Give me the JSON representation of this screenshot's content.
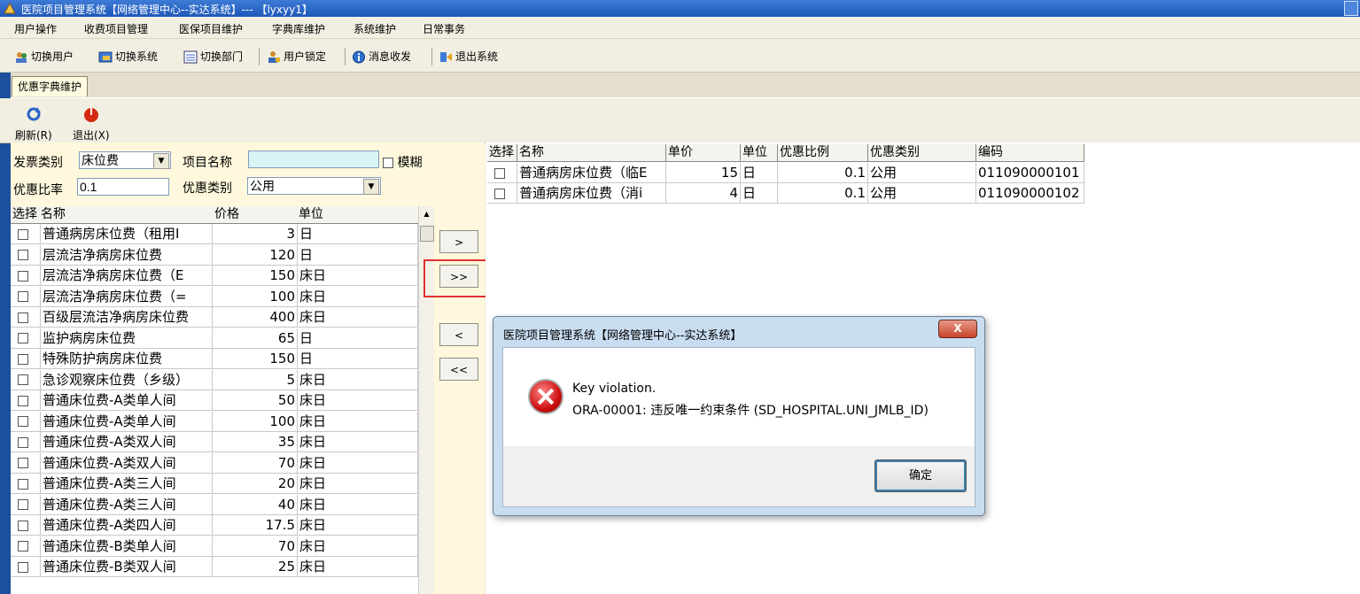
{
  "window": {
    "title": "医院项目管理系统【网络管理中心--实达系统】--- 【lyxyy1】"
  },
  "menu": [
    "用户操作",
    "收费项目管理",
    "医保项目维护",
    "字典库维护",
    "系统维护",
    "日常事务"
  ],
  "toolbar": [
    {
      "label": "切换用户",
      "icon": "users-icon"
    },
    {
      "label": "切换系统",
      "icon": "switch-system-icon"
    },
    {
      "label": "切换部门",
      "icon": "department-icon"
    },
    {
      "label": "用户锁定",
      "icon": "lock-user-icon"
    },
    {
      "label": "消息收发",
      "icon": "info-icon"
    },
    {
      "label": "退出系统",
      "icon": "exit-icon"
    }
  ],
  "tab": {
    "label": "优惠字典维护"
  },
  "actions": {
    "refresh": "刷新(R)",
    "exit": "退出(X)"
  },
  "filter": {
    "invoice_type_label": "发票类别",
    "invoice_type_value": "床位费",
    "item_name_label": "项目名称",
    "item_name_value": "",
    "fuzzy_label": "模糊",
    "discount_rate_label": "优惠比率",
    "discount_rate_value": "0.1",
    "discount_type_label": "优惠类别",
    "discount_type_value": "公用"
  },
  "left_grid": {
    "headers": [
      "选择",
      "名称",
      "价格",
      "单位"
    ],
    "rows": [
      {
        "name": "普通病房床位费（租用I",
        "price": "3",
        "unit": "日"
      },
      {
        "name": "层流洁净病房床位费",
        "price": "120",
        "unit": "日"
      },
      {
        "name": "层流洁净病房床位费（E",
        "price": "150",
        "unit": "床日"
      },
      {
        "name": "层流洁净病房床位费（=",
        "price": "100",
        "unit": "床日"
      },
      {
        "name": "百级层流洁净病房床位费",
        "price": "400",
        "unit": "床日"
      },
      {
        "name": "监护病房床位费",
        "price": "65",
        "unit": "日"
      },
      {
        "name": "特殊防护病房床位费",
        "price": "150",
        "unit": "日"
      },
      {
        "name": "急诊观察床位费（乡级）",
        "price": "5",
        "unit": "床日"
      },
      {
        "name": "普通床位费-A类单人间",
        "price": "50",
        "unit": "床日"
      },
      {
        "name": "普通床位费-A类单人间",
        "price": "100",
        "unit": "床日"
      },
      {
        "name": "普通床位费-A类双人间",
        "price": "35",
        "unit": "床日"
      },
      {
        "name": "普通床位费-A类双人间",
        "price": "70",
        "unit": "床日"
      },
      {
        "name": "普通床位费-A类三人间",
        "price": "20",
        "unit": "床日"
      },
      {
        "name": "普通床位费-A类三人间",
        "price": "40",
        "unit": "床日"
      },
      {
        "name": "普通床位费-A类四人间",
        "price": "17.5",
        "unit": "床日"
      },
      {
        "name": "普通床位费-B类单人间",
        "price": "70",
        "unit": "床日"
      },
      {
        "name": "普通床位费-B类双人间",
        "price": "25",
        "unit": "床日"
      }
    ]
  },
  "transfer_buttons": [
    ">",
    ">>",
    "<",
    "<<"
  ],
  "right_grid": {
    "headers": [
      "选择",
      "名称",
      "单价",
      "单位",
      "优惠比例",
      "优惠类别",
      "编码"
    ],
    "rows": [
      {
        "name": "普通病房床位费（临E",
        "price": "15",
        "unit": "日",
        "ratio": "0.1",
        "type": "公用",
        "code": "011090000101"
      },
      {
        "name": "普通病房床位费（消i",
        "price": "4",
        "unit": "日",
        "ratio": "0.1",
        "type": "公用",
        "code": "011090000102"
      }
    ]
  },
  "dialog": {
    "title": "医院项目管理系统【网络管理中心--实达系统】",
    "close": "X",
    "message_line1": "Key violation.",
    "message_line2": "ORA-00001: 违反唯一约束条件 (SD_HOSPITAL.UNI_JMLB_ID)",
    "ok": "确定"
  },
  "colors": {
    "titlebar": "#2a64c5",
    "panel_bg": "#fff8dc",
    "highlight": "#e03030",
    "error": "#cc1111"
  }
}
